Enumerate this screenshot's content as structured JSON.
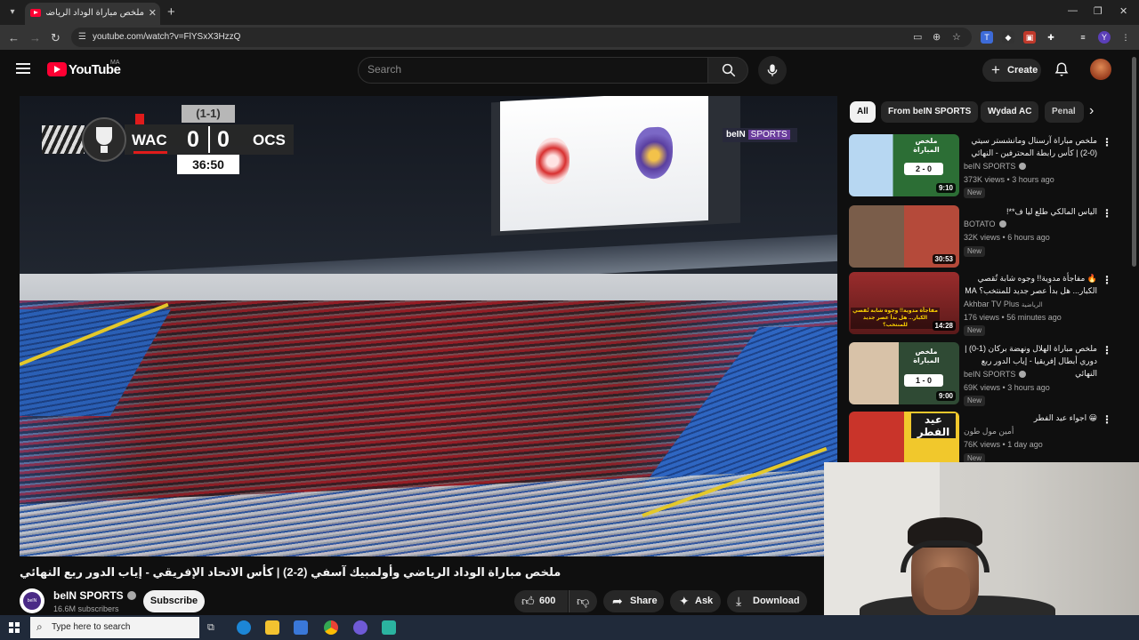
{
  "browser": {
    "tab_title": "ملخص مباراة الوداد الرياضي",
    "tab_close": "✕",
    "new_tab": "+",
    "url": "youtube.com/watch?v=FlYSxX3HzzQ",
    "window_controls": [
      "—",
      "❐",
      "✕"
    ]
  },
  "header": {
    "logo_text": "YouTube",
    "country_code": "MA",
    "search_placeholder": "Search",
    "create_label": "Create"
  },
  "player": {
    "scoreboard": {
      "home_team": "WAC",
      "away_team": "OCS",
      "home_score": "0",
      "away_score": "0",
      "aggregate": "(1-1)",
      "clock": "36:50"
    },
    "broadcaster": {
      "name": "beIN",
      "suffix": "SPORTS"
    }
  },
  "video": {
    "title": "ملخص مباراة الوداد الرياضي وأولمبيك آسفي (2-2) | كأس الاتحاد الإفريقي - إياب الدور ربع النهائي",
    "channel": "beIN SPORTS",
    "subscribers": "16.6M subscribers",
    "subscribe_label": "Subscribe",
    "likes": "600",
    "share_label": "Share",
    "ask_label": "Ask",
    "download_label": "Download"
  },
  "sidebar": {
    "chips": [
      "All",
      "From beIN SPORTS",
      "Wydad AC",
      "Penal"
    ],
    "recommendations": [
      {
        "title": "ملخص مباراة آرسنال ومانشستر سيتي (0-2) | كأس رابطة المحترفين - النهائي",
        "channel": "beIN SPORTS",
        "views": "373K views",
        "age": "3 hours ago",
        "badge": "New",
        "duration": "9:10",
        "thumb_text": "ملخص المباراة",
        "thumb_score": "2 - 0",
        "verified": true
      },
      {
        "title": "الياس المالكي طلع ليا ف**!",
        "channel": "BOTATO",
        "views": "32K views",
        "age": "6 hours ago",
        "badge": "New",
        "duration": "30:53",
        "verified": true
      },
      {
        "title": "🔥 مفاجأة مدوية!! وجوه شابة تُقصي الكبار... هل بدأ عصر جديد للمنتخب؟ MA",
        "channel": "Akhbar TV Plus",
        "channel_suffix": "الرياضية",
        "views": "176 views",
        "age": "56 minutes ago",
        "badge": "New",
        "duration": "14:28",
        "thumb_text": "مفاجأة مدوية!! وجوه شابة تُقصي الكبار... هل بدأ عصر جديد للمنتخب؟",
        "verified": false
      },
      {
        "title": "ملخص مباراة الهلال ونهضة بركان (1-0) | دوري أبطال إفريقيا - إياب الدور ربع النهائي",
        "channel": "beIN SPORTS",
        "views": "69K views",
        "age": "3 hours ago",
        "badge": "New",
        "duration": "9:00",
        "thumb_text": "ملخص المباراة",
        "thumb_score": "1 - 0",
        "verified": true
      },
      {
        "title": "😀 اجواء عيد الفطر",
        "channel": "أمين مول طون",
        "views": "76K views",
        "age": "1 day ago",
        "badge": "New",
        "thumb_text": "عيد الفطر",
        "verified": false
      }
    ]
  },
  "taskbar": {
    "search_placeholder": "Type here to search"
  },
  "colors": {
    "yt_red": "#ff0033",
    "background": "#0f0f0f",
    "chip_bg": "#272727",
    "scoreboard_red": "#e01b1b",
    "bein_purple": "#6a3c9c"
  }
}
